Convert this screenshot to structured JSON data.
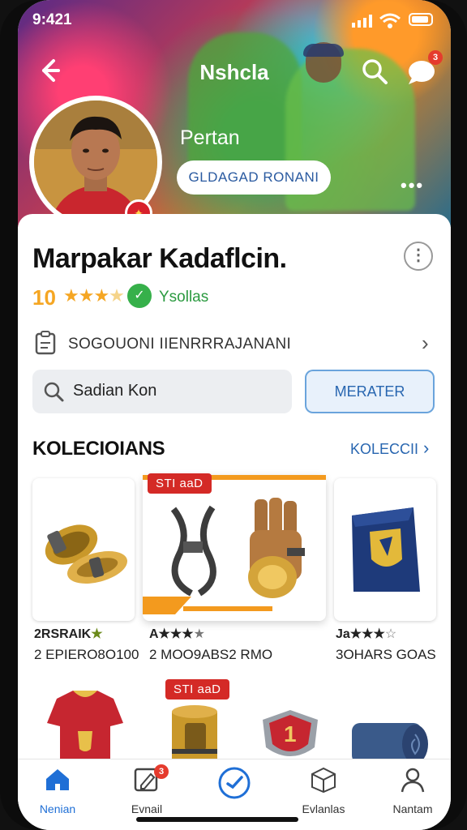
{
  "status_bar": {
    "time": "9:421"
  },
  "header": {
    "title": "Nshcla",
    "chat_badge": "3"
  },
  "hero": {
    "name": "Pertan",
    "follow_label": "GLDAGAD RONANI",
    "more": "•••"
  },
  "profile": {
    "name": "Marpakar Kadaflcin.",
    "rating": "10",
    "stars": "★★★",
    "stars_dim": "★",
    "verified_label": "Ysollas",
    "link_text": "SOGOUONI IIENRRRAJANANI"
  },
  "search": {
    "value": "Sadian Kon"
  },
  "action_button": {
    "label": "MERATER"
  },
  "collection": {
    "title": "KOLECIOIANS",
    "see_all": "KOLECCII",
    "items": [
      {
        "rating": "2RSRAIK",
        "star": "★",
        "price": "2 EPIERO8O100"
      },
      {
        "tag": "STI ааD",
        "rating": "A★★★",
        "star": "★",
        "price": "2 MOO9ABS2 RMO"
      },
      {
        "rating": "Ja★★★",
        "star": "☆",
        "price": "3OHARS GOAS"
      }
    ],
    "row2_tag": "STI ааD",
    "row2_shield_number": "1"
  },
  "bottom_nav": [
    {
      "label": "Nenian",
      "icon": "home-icon"
    },
    {
      "label": "Evnail",
      "icon": "edit-icon",
      "badge": "3"
    },
    {
      "label": "",
      "icon": "add-icon"
    },
    {
      "label": "Evlanlas",
      "icon": "box-icon"
    },
    {
      "label": "Nantam",
      "icon": "profile-icon"
    }
  ],
  "colors": {
    "accent": "#1f6fd6",
    "rating": "#f5a623",
    "verified": "#36b04a",
    "tag": "#d42a26"
  }
}
